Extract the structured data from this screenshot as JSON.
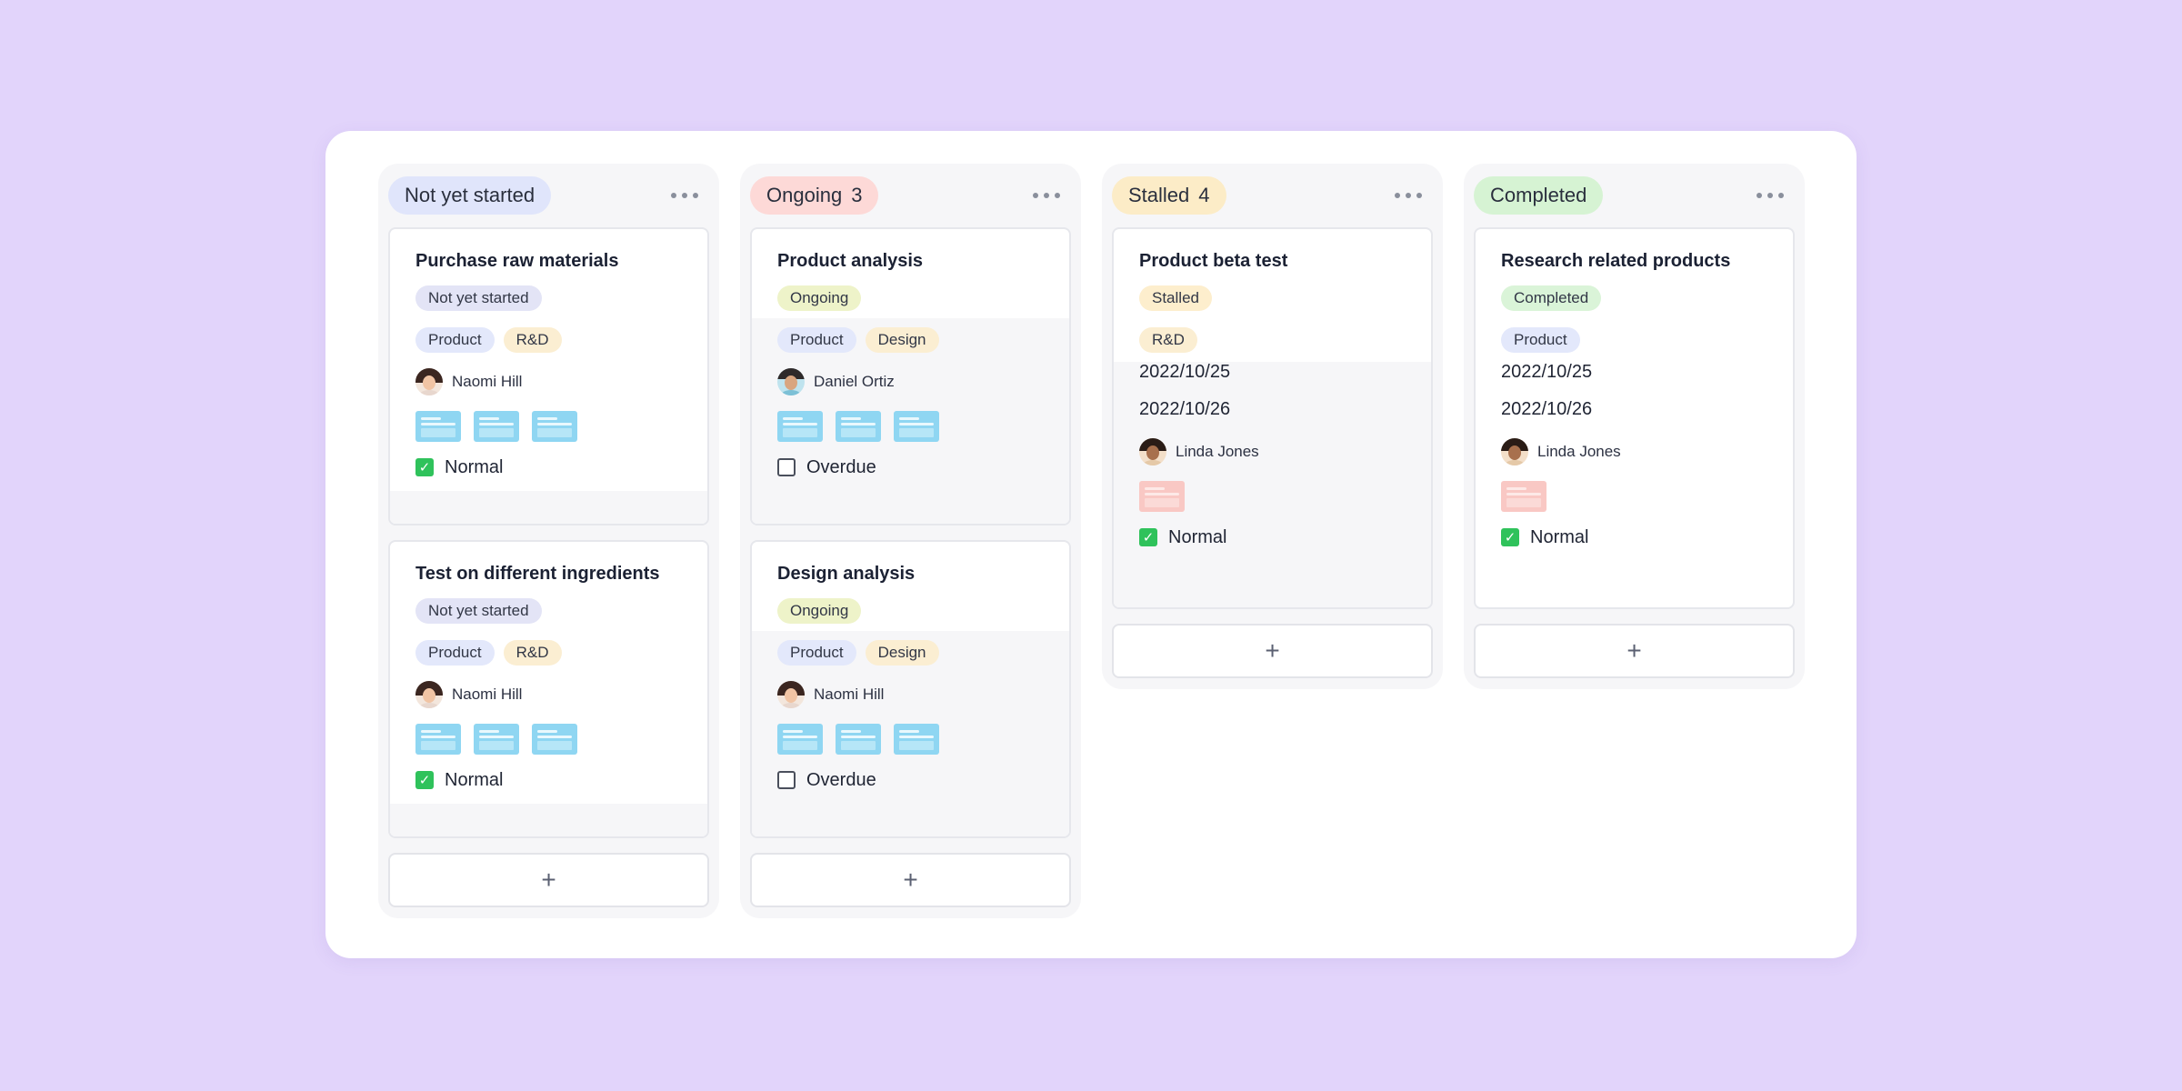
{
  "colors": {
    "background": "#e2d4fb",
    "not_started": "#e0e5fb",
    "ongoing": "#fdd9d7",
    "stalled": "#fcecc7",
    "completed": "#d6f3d3",
    "tag_product": "#e3e8fb",
    "tag_rnd": "#fbeed2",
    "tag_design": "#fbeed2",
    "chip_ongoing": "#eef3c9",
    "chip_stalled": "#fdeecd",
    "chip_completed": "#daf4d8",
    "chip_not_started": "#e3e4f6",
    "check_green": "#2fc25b"
  },
  "columns": [
    {
      "status": "Not yet started",
      "count": "",
      "cards": [
        {
          "title": "Purchase raw materials",
          "status_chip": "Not yet started",
          "tags": [
            "Product",
            "R&D"
          ],
          "assignee": "Naomi Hill",
          "attachments": 3,
          "check_label": "Normal",
          "checked": true
        },
        {
          "title": "Test on different ingredients",
          "status_chip": "Not yet started",
          "tags": [
            "Product",
            "R&D"
          ],
          "assignee": "Naomi Hill",
          "attachments": 3,
          "check_label": "Normal",
          "checked": true
        }
      ],
      "add_label": "+"
    },
    {
      "status": "Ongoing",
      "count": "3",
      "cards": [
        {
          "title": "Product analysis",
          "status_chip": "Ongoing",
          "tags": [
            "Product",
            "Design"
          ],
          "assignee": "Daniel Ortiz",
          "attachments": 3,
          "check_label": "Overdue",
          "checked": false
        },
        {
          "title": "Design analysis",
          "status_chip": "Ongoing",
          "tags": [
            "Product",
            "Design"
          ],
          "assignee": "Naomi Hill",
          "attachments": 3,
          "check_label": "Overdue",
          "checked": false
        }
      ],
      "add_label": "+"
    },
    {
      "status": "Stalled",
      "count": "4",
      "cards": [
        {
          "title": "Product beta test",
          "status_chip": "Stalled",
          "tags": [
            "R&D"
          ],
          "start_date": "2022/10/25",
          "end_date": "2022/10/26",
          "assignee": "Linda Jones",
          "attachments": 1,
          "check_label": "Normal",
          "checked": true
        }
      ],
      "add_label": "+"
    },
    {
      "status": "Completed",
      "count": "",
      "cards": [
        {
          "title": "Research related products",
          "status_chip": "Completed",
          "tags": [
            "Product"
          ],
          "start_date": "2022/10/25",
          "end_date": "2022/10/26",
          "assignee": "Linda Jones",
          "attachments": 1,
          "check_label": "Normal",
          "checked": true
        }
      ],
      "add_label": "+"
    }
  ]
}
